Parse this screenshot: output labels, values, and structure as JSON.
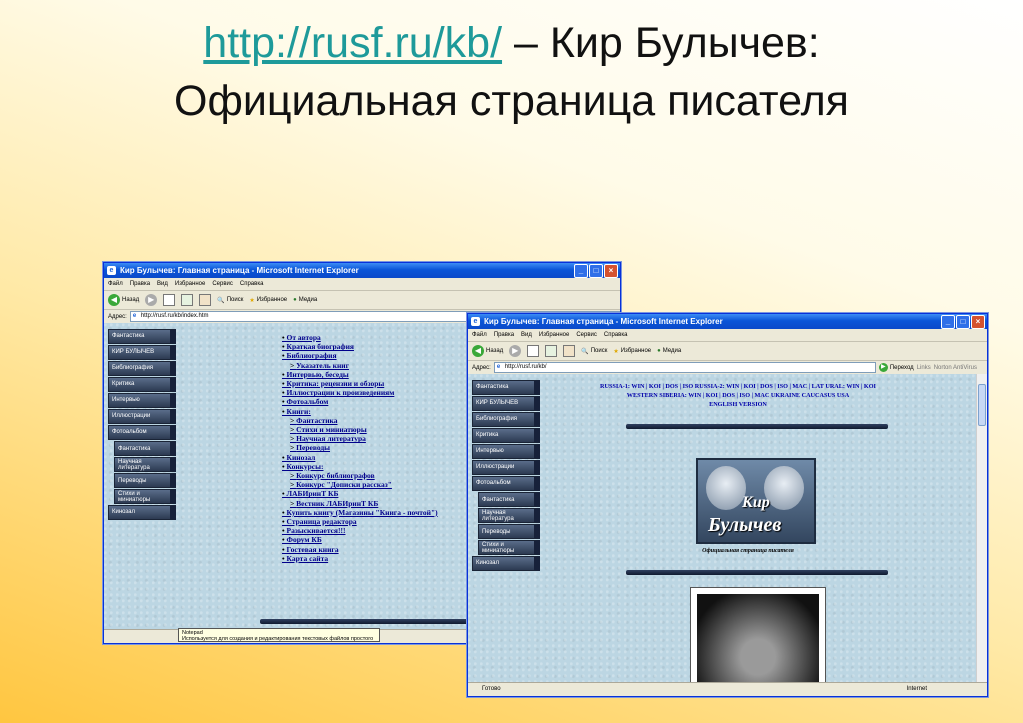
{
  "slide": {
    "title_link": "http://rusf.ru/kb/",
    "title_rest": " – Кир Булычев:",
    "title_line2": "Официальная страница писателя"
  },
  "window1": {
    "title": "Кир Булычев: Главная страница - Microsoft Internet Explorer",
    "menu": [
      "Файл",
      "Правка",
      "Вид",
      "Избранное",
      "Сервис",
      "Справка"
    ],
    "toolbar": {
      "back": "Назад",
      "search": "Поиск",
      "favorites": "Избранное",
      "media": "Медиа"
    },
    "address_label": "Адрес:",
    "address_value": "http://rusf.ru/kb/index.htm",
    "nav": [
      "Фантастика",
      "КИР БУЛЫЧЕВ",
      "Библиография",
      "Критика",
      "Интервью",
      "Иллюстрации",
      "Фотоальбом"
    ],
    "nav_sub": [
      "Фантастика",
      "Научная литература",
      "Переводы",
      "Стихи и миниатюры"
    ],
    "nav_bottom": "Кинозал",
    "links": [
      {
        "t": "item",
        "text": "От автора"
      },
      {
        "t": "item",
        "text": "Краткая биография"
      },
      {
        "t": "item",
        "text": "Библиография"
      },
      {
        "t": "sub",
        "text": "Указатель книг"
      },
      {
        "t": "item",
        "text": "Интервью, беседы"
      },
      {
        "t": "item",
        "text": "Критика: рецензии и обзоры"
      },
      {
        "t": "item",
        "text": "Иллюстрации к произведениям"
      },
      {
        "t": "item",
        "text": "Фотоальбом"
      },
      {
        "t": "item",
        "text": "Книги:"
      },
      {
        "t": "sub",
        "text": "Фантастика"
      },
      {
        "t": "sub",
        "text": "Стихи и миниатюры"
      },
      {
        "t": "sub",
        "text": "Научная литература"
      },
      {
        "t": "sub",
        "text": "Переводы"
      },
      {
        "t": "item",
        "text": "Кинозал"
      },
      {
        "t": "item",
        "text": "Конкурсы:"
      },
      {
        "t": "sub",
        "text": "Конкурс библиографов"
      },
      {
        "t": "sub",
        "text": "Конкурс \"Дописки рассказ\""
      },
      {
        "t": "item",
        "text": "ЛАБИринТ КБ"
      },
      {
        "t": "sub",
        "text": "Вестник ЛАБИринТ КБ"
      },
      {
        "t": "item",
        "text": "Купить книгу (Магазины \"Книга - почтой\")"
      },
      {
        "t": "item",
        "text": "Страница редактора"
      },
      {
        "t": "item",
        "text": "Разыскивается!!!"
      },
      {
        "t": "item",
        "text": "Форум КБ"
      },
      {
        "t": "item",
        "text": "Гостевая книга"
      },
      {
        "t": "item",
        "text": "Карта сайта"
      }
    ],
    "notepad_title": "Notepad",
    "notepad_text": "Используется для создания и редактирования текстовых файлов простого"
  },
  "window2": {
    "title": "Кир Булычев: Главная страница - Microsoft Internet Explorer",
    "menu": [
      "Файл",
      "Правка",
      "Вид",
      "Избранное",
      "Сервис",
      "Справка"
    ],
    "toolbar": {
      "back": "Назад",
      "search": "Поиск",
      "favorites": "Избранное",
      "media": "Медиа"
    },
    "address_label": "Адрес:",
    "address_value": "http://rusf.ru/kb/",
    "go": "Переход",
    "links_label": "Links",
    "norton": "Norton AntiVirus",
    "regions_line1": "RUSSIA-1: WIN | KOI | DOS | ISO  RUSSIA-2: WIN | KOI | DOS | ISO | MAC | LAT  URAL: WIN | KOI",
    "regions_line2": "WESTERN SIBERIA: WIN | KOI | DOS | ISO | MAC  UKRAINE  CAUCASUS  USA",
    "regions_line3": "ENGLISH VERSION",
    "logo_line1": "Кир",
    "logo_line2": "Булычев",
    "tagline": "Официальная страница писателя",
    "status_left": "Готово",
    "status_right": "Internet"
  }
}
